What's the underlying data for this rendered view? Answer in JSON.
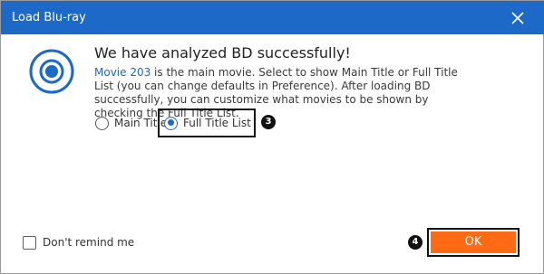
{
  "window": {
    "title": "Load Blu-ray",
    "close_icon": "close-icon"
  },
  "message": {
    "icon": "disc-icon",
    "headline": "We have analyzed BD successfully!",
    "movie_link": "Movie 203",
    "description_rest": " is the main movie. Select to show Main Title or Full Title List (you can change defaults in Preference). After loading BD successfully, you can customize what movies to be shown by checking the Full Title List."
  },
  "options": {
    "main_title": {
      "label": "Main Title",
      "checked": false
    },
    "full_title_list": {
      "label": "Full Title List",
      "checked": true
    }
  },
  "annotations": {
    "step_3": "3",
    "step_4": "4"
  },
  "footer": {
    "dont_remind_label": "Don't remind me",
    "dont_remind_checked": false,
    "ok_label": "OK"
  },
  "colors": {
    "titlebar": "#1c69c7",
    "accent": "#1c69c7",
    "ok_button": "#ff6a13"
  }
}
